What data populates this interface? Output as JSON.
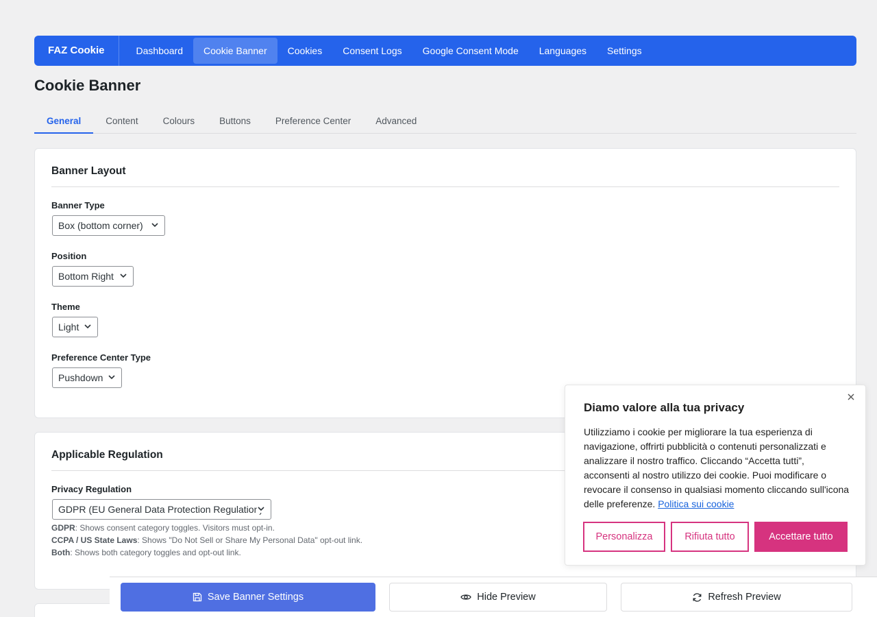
{
  "nav": {
    "brand": "FAZ Cookie",
    "items": [
      {
        "label": "Dashboard"
      },
      {
        "label": "Cookie Banner"
      },
      {
        "label": "Cookies"
      },
      {
        "label": "Consent Logs"
      },
      {
        "label": "Google Consent Mode"
      },
      {
        "label": "Languages"
      },
      {
        "label": "Settings"
      }
    ],
    "active": "Cookie Banner",
    "color": "#2563eb"
  },
  "page": {
    "title": "Cookie Banner"
  },
  "tabs": {
    "items": [
      {
        "label": "General"
      },
      {
        "label": "Content"
      },
      {
        "label": "Colours"
      },
      {
        "label": "Buttons"
      },
      {
        "label": "Preference Center"
      },
      {
        "label": "Advanced"
      }
    ],
    "active": "General"
  },
  "layout_card": {
    "title": "Banner Layout",
    "banner_type": {
      "label": "Banner Type",
      "value": "Box (bottom corner)"
    },
    "position": {
      "label": "Position",
      "value": "Bottom Right"
    },
    "theme": {
      "label": "Theme",
      "value": "Light"
    },
    "pref_center_type": {
      "label": "Preference Center Type",
      "value": "Pushdown"
    }
  },
  "regulation_card": {
    "title": "Applicable Regulation",
    "privacy_regulation": {
      "label": "Privacy Regulation",
      "value": "GDPR (EU General Data Protection Regulation)"
    },
    "help": [
      {
        "term": "GDPR",
        "text": ": Shows consent category toggles. Visitors must opt-in."
      },
      {
        "term": "CCPA / US State Laws",
        "text": ": Shows \"Do Not Sell or Share My Personal Data\" opt-out link."
      },
      {
        "term": "Both",
        "text": ": Shows both category toggles and opt-out link."
      }
    ]
  },
  "banner": {
    "title": "Diamo valore alla tua privacy",
    "text": "Utilizziamo i cookie per migliorare la tua esperienza di navigazione, offrirti pubblicità o contenuti personalizzati e analizzare il nostro traffico. Cliccando “Accetta tutti”, acconsenti al nostro utilizzo dei cookie. Puoi modificare o revocare il consenso in qualsiasi momento cliccando sull'icona delle preferenze.",
    "link": "Politica sui cookie",
    "buttons": {
      "customize": "Personalizza",
      "reject": "Rifiuta tutto",
      "accept": "Accettare tutto"
    },
    "accent_color": "#d6337f",
    "link_color": "#1863dc"
  },
  "actions": {
    "save": "Save Banner Settings",
    "hide": "Hide Preview",
    "refresh": "Refresh Preview"
  }
}
